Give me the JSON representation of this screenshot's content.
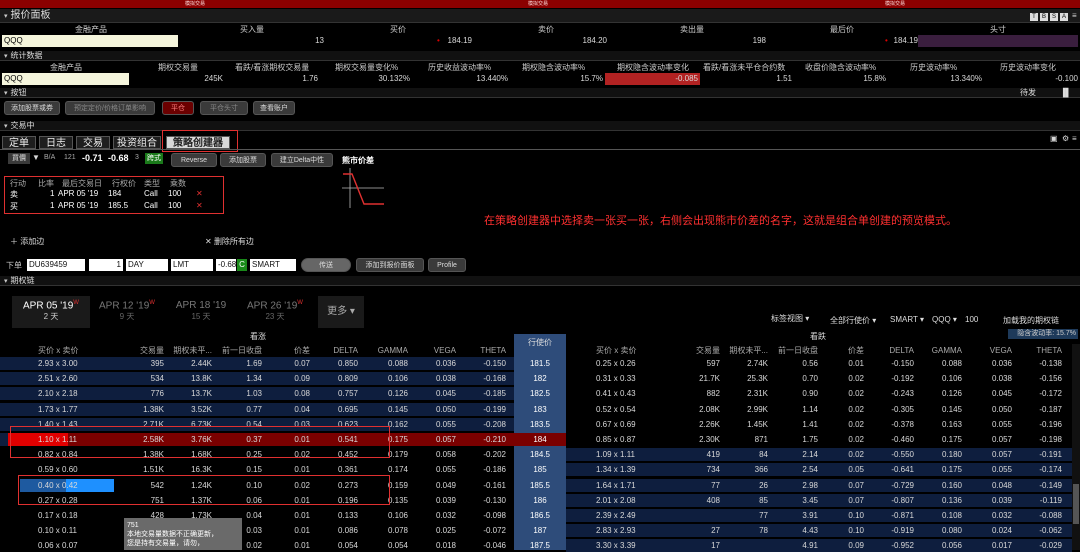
{
  "topbar": {
    "labels": [
      "模拟交易",
      "模拟交易",
      "模拟交易"
    ]
  },
  "quote_panel": {
    "title": "报价面板",
    "corner_icons": [
      "T",
      "B",
      "S",
      "A"
    ],
    "headers": [
      "金融产品",
      "买入量",
      "买价",
      "卖价",
      "卖出量",
      "最后价",
      "头寸"
    ],
    "row": {
      "symbol": "QQQ",
      "bid_size": "13",
      "bid": "184.19",
      "ask": "184.20",
      "ask_size": "198",
      "last": "184.19",
      "position": ""
    }
  },
  "stats_panel": {
    "title": "统计数据",
    "headers": [
      "金融产品",
      "期权交易量",
      "看跌/看涨期权交易量",
      "期权交易量变化%",
      "历史收益波动率%",
      "期权隐含波动率%",
      "期权隐含波动率变化",
      "看跌/看涨未平仓合约数",
      "收盘价隐含波动率%",
      "历史波动率%",
      "历史波动率变化"
    ],
    "row": [
      "QQQ",
      "245K",
      "1.76",
      "30.132%",
      "13.440%",
      "15.7%",
      "-0.085",
      "1.51",
      "15.8%",
      "13.340%",
      "-0.100"
    ]
  },
  "buttons_panel": {
    "title": "按钮",
    "right_label": "待发",
    "buttons": [
      "添加股票或券",
      "预定定价/价格订单影响",
      "平仓",
      "平仓头寸",
      "查看账户"
    ]
  },
  "trade_panel": {
    "title": "交易中",
    "tabs": [
      "定单",
      "日志",
      "交易",
      "投资组合",
      "策略创建器"
    ],
    "strategy_bar": {
      "exchange": "買價",
      "ba": "B/A",
      "qty": "121",
      "bid": "-0.71",
      "ask": "-0.68",
      "size": "3",
      "badge": "跨式",
      "reverse": "Reverse",
      "add_stock": "添加股票",
      "delta_neutral": "建立Delta中性"
    },
    "leg_headers": [
      "行动",
      "比率",
      "最后交易日",
      "行权价",
      "类型",
      "乘数"
    ],
    "legs": [
      {
        "action": "卖",
        "ratio": "1",
        "date": "APR 05 '19",
        "strike": "184",
        "type": "Call",
        "mult": "100"
      },
      {
        "action": "买",
        "ratio": "1",
        "date": "APR 05 '19",
        "strike": "185.5",
        "type": "Call",
        "mult": "100"
      }
    ],
    "spread_label": "熊市价差",
    "annotation": "在策略创建器中选择卖一张买一张，右侧会出现熊市价差的名字，这就是组合单创建的预览模式。",
    "add_leg": "添加边",
    "remove_all": "删除所有边",
    "order": {
      "prefix": "下单",
      "account": "DU639459",
      "qty": "1",
      "tif": "DAY",
      "type": "LMT",
      "price": "-0.68",
      "c": "C",
      "route": "SMART",
      "submit": "传送",
      "add_quote": "添加到报价面板",
      "profile": "Profile"
    }
  },
  "chain_panel": {
    "title": "期权链",
    "date_tabs": [
      {
        "date": "APR 05 '19",
        "days": "2 天",
        "active": true
      },
      {
        "date": "APR 12 '19",
        "days": "9 天",
        "active": false
      },
      {
        "date": "APR 18 '19",
        "days": "15 天",
        "active": false
      },
      {
        "date": "APR 26 '19",
        "days": "23 天",
        "active": false
      }
    ],
    "more": "更多",
    "controls": {
      "view": "标签视图",
      "all_strikes": "全部行使价",
      "route": "SMART",
      "symbol": "QQQ",
      "count": "100",
      "load": "加载我的期权链",
      "iv_note": "隐含波动率: 15.7%"
    },
    "calls_label": "看涨",
    "puts_label": "看跌",
    "strike_header": "行使价",
    "call_headers": [
      "买价 x 卖价",
      "交易量",
      "期权未平...",
      "前一日收盘",
      "价差",
      "DELTA",
      "GAMMA",
      "VEGA",
      "THETA"
    ],
    "put_headers": [
      "买价 x 卖价",
      "交易量",
      "期权未平...",
      "前一日收盘",
      "价差",
      "DELTA",
      "GAMMA",
      "VEGA",
      "THETA"
    ],
    "rows": [
      {
        "c": [
          "2.93 x 3.00",
          "395",
          "2.44K",
          "1.69",
          "0.07",
          "0.850",
          "0.088",
          "0.036",
          "-0.150"
        ],
        "k": "181.5",
        "p": [
          "0.25 x 0.26",
          "597",
          "2.74K",
          "0.56",
          "0.01",
          "-0.150",
          "0.088",
          "0.036",
          "-0.138"
        ]
      },
      {
        "c": [
          "2.51 x 2.60",
          "534",
          "13.8K",
          "1.34",
          "0.09",
          "0.809",
          "0.106",
          "0.038",
          "-0.168"
        ],
        "k": "182",
        "p": [
          "0.31 x 0.33",
          "21.7K",
          "25.3K",
          "0.70",
          "0.02",
          "-0.192",
          "0.106",
          "0.038",
          "-0.156"
        ]
      },
      {
        "c": [
          "2.10 x 2.18",
          "776",
          "13.7K",
          "1.03",
          "0.08",
          "0.757",
          "0.126",
          "0.045",
          "-0.185"
        ],
        "k": "182.5",
        "p": [
          "0.41 x 0.43",
          "882",
          "2.31K",
          "0.90",
          "0.02",
          "-0.243",
          "0.126",
          "0.045",
          "-0.172"
        ]
      },
      {
        "c": [
          "1.73 x 1.77",
          "1.38K",
          "3.52K",
          "0.77",
          "0.04",
          "0.695",
          "0.145",
          "0.050",
          "-0.199"
        ],
        "k": "183",
        "p": [
          "0.52 x 0.54",
          "2.08K",
          "2.99K",
          "1.14",
          "0.02",
          "-0.305",
          "0.145",
          "0.050",
          "-0.187"
        ]
      },
      {
        "c": [
          "1.40 x 1.43",
          "2.71K",
          "6.73K",
          "0.54",
          "0.03",
          "0.623",
          "0.162",
          "0.055",
          "-0.208"
        ],
        "k": "183.5",
        "p": [
          "0.67 x 0.69",
          "2.26K",
          "1.45K",
          "1.41",
          "0.02",
          "-0.378",
          "0.163",
          "0.055",
          "-0.196"
        ]
      },
      {
        "c": [
          "1.10 x 1.11",
          "2.58K",
          "3.76K",
          "0.37",
          "0.01",
          "0.541",
          "0.175",
          "0.057",
          "-0.210"
        ],
        "k": "184",
        "p": [
          "0.85 x 0.87",
          "2.30K",
          "871",
          "1.75",
          "0.02",
          "-0.460",
          "0.175",
          "0.057",
          "-0.198"
        ]
      },
      {
        "c": [
          "0.82 x 0.84",
          "1.38K",
          "1.68K",
          "0.25",
          "0.02",
          "0.452",
          "0.179",
          "0.058",
          "-0.202"
        ],
        "k": "184.5",
        "p": [
          "1.09 x 1.11",
          "419",
          "84",
          "2.14",
          "0.02",
          "-0.550",
          "0.180",
          "0.057",
          "-0.191"
        ]
      },
      {
        "c": [
          "0.59 x 0.60",
          "1.51K",
          "16.3K",
          "0.15",
          "0.01",
          "0.361",
          "0.174",
          "0.055",
          "-0.186"
        ],
        "k": "185",
        "p": [
          "1.34 x 1.39",
          "734",
          "366",
          "2.54",
          "0.05",
          "-0.641",
          "0.175",
          "0.055",
          "-0.174"
        ]
      },
      {
        "c": [
          "0.40 x 0.42",
          "542",
          "1.24K",
          "0.10",
          "0.02",
          "0.273",
          "0.159",
          "0.049",
          "-0.161"
        ],
        "k": "185.5",
        "p": [
          "1.64 x 1.71",
          "77",
          "26",
          "2.98",
          "0.07",
          "-0.729",
          "0.160",
          "0.048",
          "-0.149"
        ]
      },
      {
        "c": [
          "0.27 x 0.28",
          "751",
          "1.37K",
          "0.06",
          "0.01",
          "0.196",
          "0.135",
          "0.039",
          "-0.130"
        ],
        "k": "186",
        "p": [
          "2.01 x 2.08",
          "408",
          "85",
          "3.45",
          "0.07",
          "-0.807",
          "0.136",
          "0.039",
          "-0.119"
        ]
      },
      {
        "c": [
          "0.17 x 0.18",
          "428",
          "1.73K",
          "0.04",
          "0.01",
          "0.133",
          "0.106",
          "0.032",
          "-0.098"
        ],
        "k": "186.5",
        "p": [
          "2.39 x 2.49",
          "",
          "77",
          "3.91",
          "0.10",
          "-0.871",
          "0.108",
          "0.032",
          "-0.088"
        ]
      },
      {
        "c": [
          "0.10 x 0.11",
          "",
          "",
          "0.03",
          "0.01",
          "0.086",
          "0.078",
          "0.025",
          "-0.072"
        ],
        "k": "187",
        "p": [
          "2.83 x 2.93",
          "27",
          "78",
          "4.43",
          "0.10",
          "-0.919",
          "0.080",
          "0.024",
          "-0.062"
        ]
      },
      {
        "c": [
          "0.06 x 0.07",
          "",
          "",
          "0.02",
          "0.01",
          "0.054",
          "0.054",
          "0.018",
          "-0.046"
        ],
        "k": "187.5",
        "p": [
          "3.30 x 3.39",
          "17",
          "",
          "4.91",
          "0.09",
          "-0.952",
          "0.056",
          "0.017",
          "-0.029"
        ]
      }
    ],
    "tooltip": {
      "line1": "751",
      "line2": "本地交易量数据不正确更新，",
      "line3": "您是持有交易量，请勿，"
    }
  }
}
